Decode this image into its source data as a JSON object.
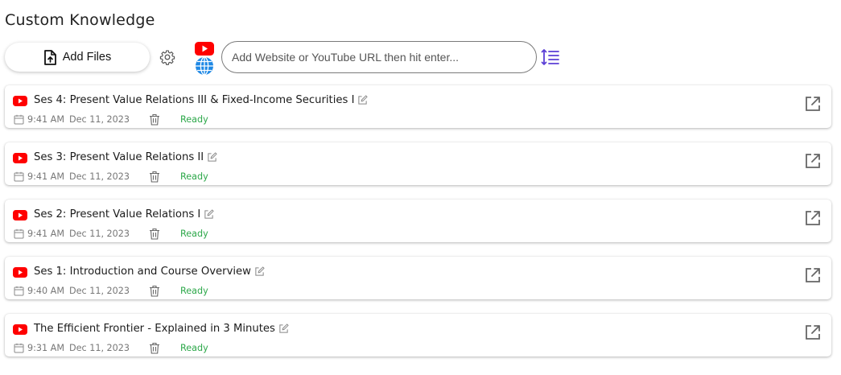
{
  "page": {
    "title": "Custom Knowledge"
  },
  "toolbar": {
    "add_files_label": "Add Files",
    "url_placeholder": "Add Website or YouTube URL then hit enter...",
    "url_value": ""
  },
  "colors": {
    "youtube": "#ff0000",
    "globe": "#1e88e5",
    "ready": "#2da84a",
    "sort": "#5b3fd6"
  },
  "items": [
    {
      "title": "Ses 4: Present Value Relations III & Fixed-Income Securities I",
      "time": "9:41 AM",
      "date": "Dec 11, 2023",
      "status": "Ready",
      "source_icon": "youtube-icon"
    },
    {
      "title": "Ses 3: Present Value Relations II",
      "time": "9:41 AM",
      "date": "Dec 11, 2023",
      "status": "Ready",
      "source_icon": "youtube-icon"
    },
    {
      "title": "Ses 2: Present Value Relations I",
      "time": "9:41 AM",
      "date": "Dec 11, 2023",
      "status": "Ready",
      "source_icon": "youtube-icon"
    },
    {
      "title": "Ses 1: Introduction and Course Overview",
      "time": "9:40 AM",
      "date": "Dec 11, 2023",
      "status": "Ready",
      "source_icon": "youtube-icon"
    },
    {
      "title": "The Efficient Frontier - Explained in 3 Minutes",
      "time": "9:31 AM",
      "date": "Dec 11, 2023",
      "status": "Ready",
      "source_icon": "youtube-icon"
    }
  ]
}
